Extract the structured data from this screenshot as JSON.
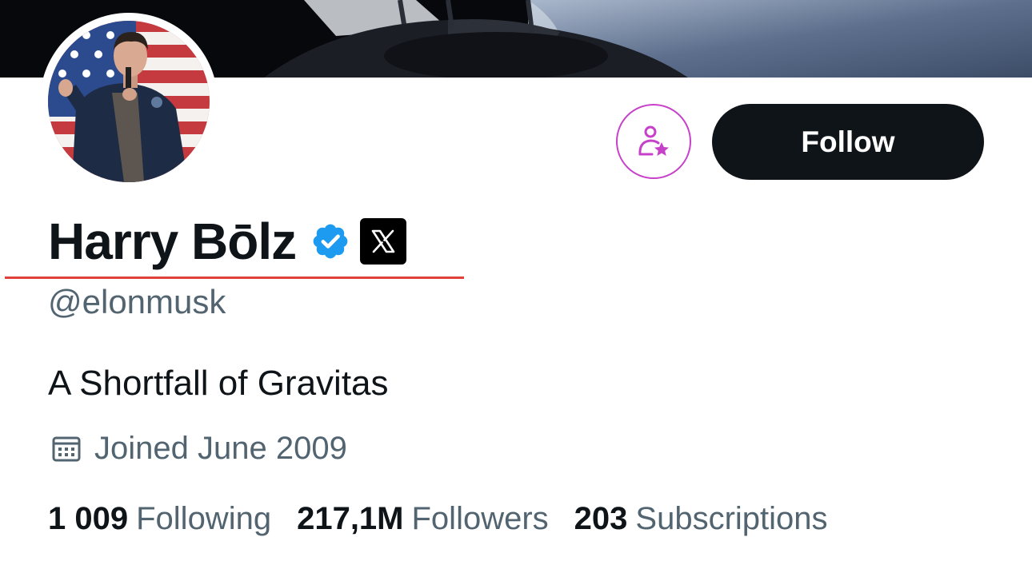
{
  "profile": {
    "display_name": "Harry Bōlz",
    "handle": "@elonmusk",
    "bio": "A Shortfall of Gravitas",
    "joined": "Joined June 2009"
  },
  "actions": {
    "follow_label": "Follow"
  },
  "stats": [
    {
      "value": "1 009",
      "label": "Following"
    },
    {
      "value": "217,1M",
      "label": "Followers"
    },
    {
      "value": "203",
      "label": "Subscriptions"
    }
  ],
  "icons": {
    "verified": "verified-badge-icon",
    "affiliate": "x-logo-icon",
    "subscribe": "person-star-icon",
    "calendar": "calendar-icon"
  },
  "colors": {
    "text_primary": "#0f1419",
    "text_secondary": "#536471",
    "verified_blue": "#1d9bf0",
    "subscribe_accent": "#c740c9",
    "underline_red": "#e0413a"
  }
}
